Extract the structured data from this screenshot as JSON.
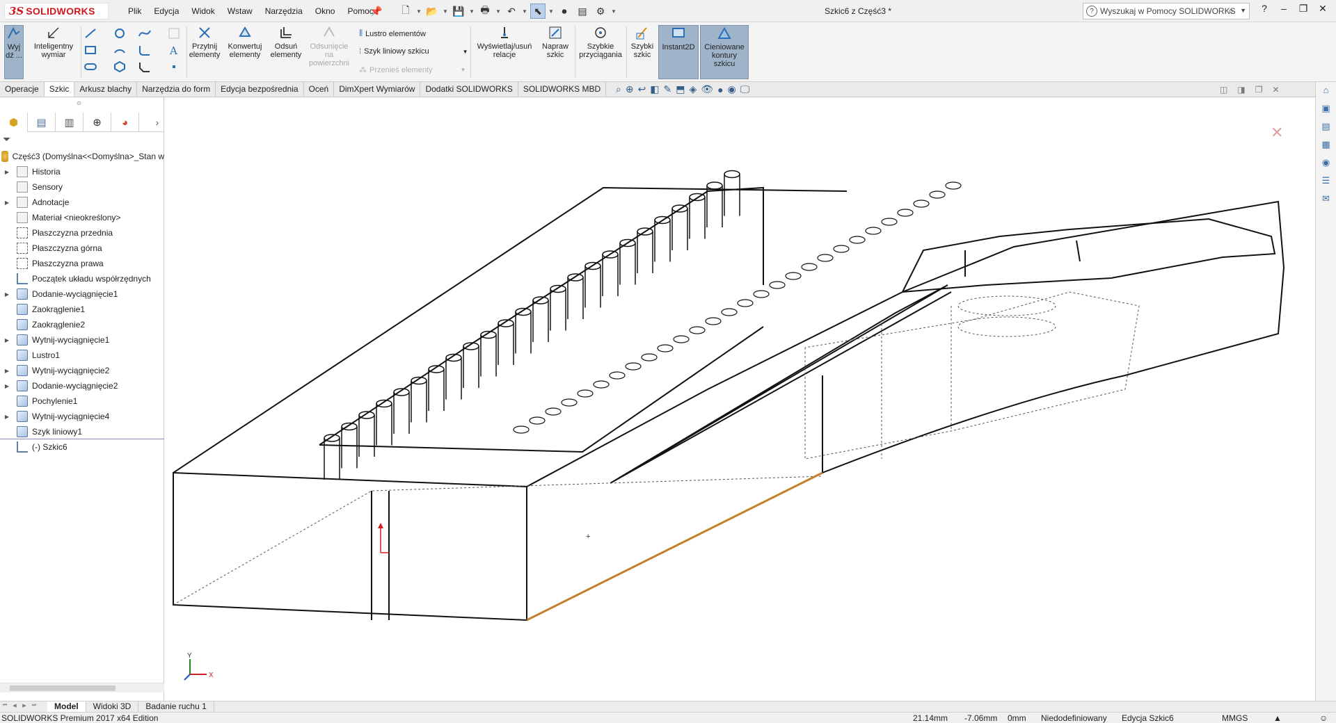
{
  "app": {
    "brand_prefix": "3S",
    "brand_name": "SOLIDWORKS",
    "document_title": "Szkic6 z Część3 *",
    "brand_color": "#d0171f"
  },
  "menu": [
    "Plik",
    "Edycja",
    "Widok",
    "Wstaw",
    "Narzędzia",
    "Okno",
    "Pomoc"
  ],
  "help_search": {
    "placeholder": "Wyszukaj w Pomocy SOLIDWORKS"
  },
  "command_manager": {
    "exit_sketch": "Wyj\ndź ...",
    "smart_dimension": "Inteligentny\nwymiar",
    "trim": "Przytnij\nelementy",
    "convert": "Konwertuj\nelementy",
    "offset": "Odsuń\nelementy",
    "offset_surface": "Odsunięcie\nna\npowierzchni",
    "mirror": "Lustro elementów",
    "linear_pattern": "Szyk liniowy szkicu",
    "move": "Przenieś elementy",
    "relations": "Wyświetlaj/usuń\nrelacje",
    "repair": "Napraw\nszkic",
    "quick_snaps": "Szybkie\nprzyciągania",
    "rapid_sketch": "Szybki\nszkic",
    "instant2d": "Instant2D",
    "shaded_contours": "Cieniowane\nkontury\nszkicu"
  },
  "tabs": [
    "Operacje",
    "Szkic",
    "Arkusz blachy",
    "Narzędzia do form",
    "Edycja bezpośrednia",
    "Oceń",
    "DimXpert Wymiarów",
    "Dodatki SOLIDWORKS",
    "SOLIDWORKS MBD"
  ],
  "active_tab": "Szkic",
  "tree": {
    "root": "Część3  (Domyślna<<Domyślna>_Stan w",
    "items": [
      {
        "label": "Historia",
        "expandable": true
      },
      {
        "label": "Sensory",
        "expandable": false
      },
      {
        "label": "Adnotacje",
        "expandable": true
      },
      {
        "label": "Materiał <nieokreślony>",
        "expandable": false
      },
      {
        "label": "Płaszczyzna przednia",
        "expandable": false
      },
      {
        "label": "Płaszczyzna górna",
        "expandable": false
      },
      {
        "label": "Płaszczyzna prawa",
        "expandable": false
      },
      {
        "label": "Początek układu współrzędnych",
        "expandable": false
      },
      {
        "label": "Dodanie-wyciągnięcie1",
        "expandable": true
      },
      {
        "label": "Zaokrąglenie1",
        "expandable": false
      },
      {
        "label": "Zaokrąglenie2",
        "expandable": false
      },
      {
        "label": "Wytnij-wyciągnięcie1",
        "expandable": true
      },
      {
        "label": "Lustro1",
        "expandable": false
      },
      {
        "label": "Wytnij-wyciągnięcie2",
        "expandable": true
      },
      {
        "label": "Dodanie-wyciągnięcie2",
        "expandable": true
      },
      {
        "label": "Pochylenie1",
        "expandable": false
      },
      {
        "label": "Wytnij-wyciągnięcie4",
        "expandable": true
      },
      {
        "label": "Szyk liniowy1",
        "expandable": false
      },
      {
        "label": "(-) Szkic6",
        "expandable": false
      }
    ]
  },
  "bottom_tabs": [
    "Model",
    "Widoki 3D",
    "Badanie ruchu 1"
  ],
  "status": {
    "edition": "SOLIDWORKS Premium 2017 x64 Edition",
    "x": "21.14mm",
    "y": "-7.06mm",
    "z": "0mm",
    "definition": "Niedodefiniowany",
    "mode": "Edycja Szkic6",
    "units": "MMGS"
  },
  "triad": {
    "y_label": "Y",
    "x_label": "X"
  },
  "colors": {
    "selected_edge": "#c47f2c",
    "triad_x": "#d12020",
    "triad_y": "#1a8a1a",
    "triad_z": "#2050c8"
  }
}
